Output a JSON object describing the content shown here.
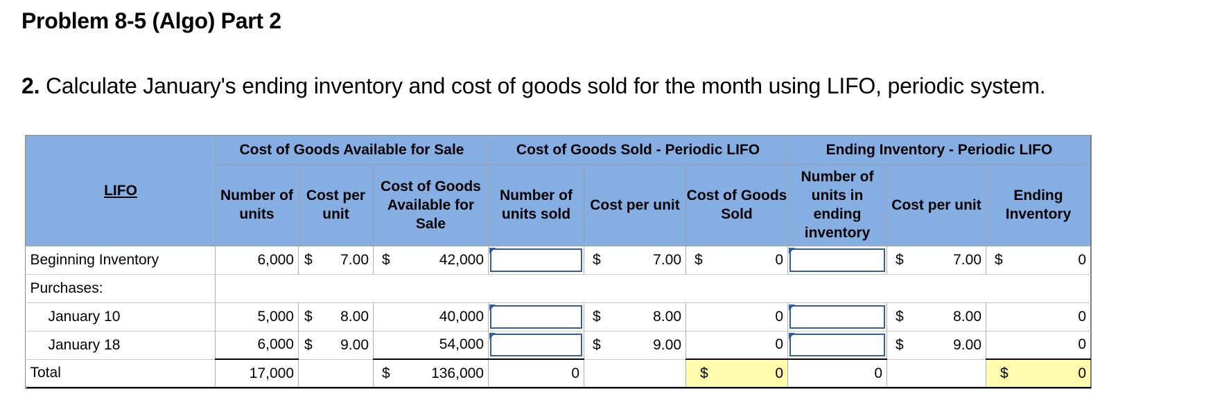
{
  "page": {
    "title": "Problem 8-5 (Algo) Part 2",
    "question_number": "2.",
    "question_text": " Calculate January's ending inventory and cost of goods sold for the month using LIFO, periodic system."
  },
  "table": {
    "corner_label": "LIFO",
    "group_headers": {
      "available": "Cost of Goods Available for Sale",
      "sold": "Cost of Goods Sold - Periodic LIFO",
      "ending": "Ending Inventory - Periodic LIFO"
    },
    "column_headers": {
      "avail_units": "Number of units",
      "avail_cost": "Cost per unit",
      "avail_total": "Cost of Goods Available for Sale",
      "sold_units": "Number of units sold",
      "sold_cost": "Cost per unit",
      "sold_total": "Cost of Goods Sold",
      "end_units": "Number of units in ending inventory",
      "end_cost": "Cost per unit",
      "end_total": "Ending Inventory"
    },
    "currency_symbol": "$",
    "rows": {
      "beginning": {
        "label": "Beginning Inventory",
        "avail_units": "6,000",
        "avail_cost": "7.00",
        "avail_total": "42,000",
        "sold_units": "",
        "sold_cost": "7.00",
        "sold_total": "0",
        "end_units": "",
        "end_cost": "7.00",
        "end_total": "0"
      },
      "purchases": {
        "label": "Purchases:"
      },
      "jan10": {
        "label": "January 10",
        "avail_units": "5,000",
        "avail_cost": "8.00",
        "avail_total": "40,000",
        "sold_units": "",
        "sold_cost": "8.00",
        "sold_total": "0",
        "end_units": "",
        "end_cost": "8.00",
        "end_total": "0"
      },
      "jan18": {
        "label": "January 18",
        "avail_units": "6,000",
        "avail_cost": "9.00",
        "avail_total": "54,000",
        "sold_units": "",
        "sold_cost": "9.00",
        "sold_total": "0",
        "end_units": "",
        "end_cost": "9.00",
        "end_total": "0"
      },
      "total": {
        "label": "Total",
        "avail_units": "17,000",
        "avail_total": "136,000",
        "sold_units": "0",
        "sold_total": "0",
        "end_units": "0",
        "end_total": "0"
      }
    },
    "colors": {
      "header_bg": "#85aee3",
      "input_border": "#2f5ea8",
      "total_highlight": "#fffbaa"
    }
  }
}
